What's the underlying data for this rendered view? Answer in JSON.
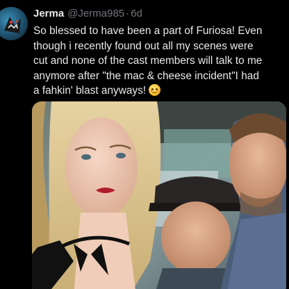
{
  "tweet": {
    "author_name": "Jerma",
    "handle": "@Jerma985",
    "separator": "·",
    "time": "6d",
    "text_lines": [
      "So blessed to have been a part of Furiosa! Even",
      "though i recently found out all my scenes were",
      "cut and none of the cast members will talk to me",
      "anymore after \"the mac & cheese incident\"I had",
      "a fahkin' blast anyways!"
    ],
    "emoji": "smiling-face-with-blush-emoji",
    "avatar_icon": "avatar-icon",
    "media": {
      "kind": "photo"
    }
  },
  "colors": {
    "background": "#000000",
    "primary_text": "#e7e9ea",
    "secondary_text": "#71767b"
  }
}
